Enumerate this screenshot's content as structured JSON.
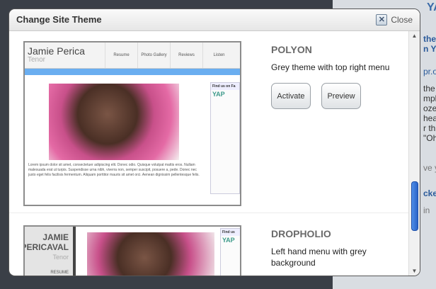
{
  "dialog": {
    "title": "Change Site Theme",
    "close_label": "Close"
  },
  "themes": [
    {
      "name": "POLYON",
      "description": "Grey theme with top right menu",
      "activate_label": "Activate",
      "preview_label": "Preview",
      "preview": {
        "site_name": "Jamie Perica",
        "site_subtitle": "Tenor",
        "nav": [
          "Resume",
          "Photo Gallery",
          "Reviews",
          "Listen"
        ],
        "sidebar_title": "Find us on Fa",
        "sidebar_brand": "YAP",
        "body_text": "Lorem ipsum dolor sit amet, consectetuer adipiscing elit. Donec odio. Quisque volutpat mattis eros. Nullam malesuada erat ut turpis. Suspendisse urna nibh, viverra non, semper suscipit, posuere a, pede. Donec nec justo eget felis facilisis fermentum. Aliquam porttitor mauris sit amet orci. Aenean dignissim pellentesque felis."
      }
    },
    {
      "name": "DROPHOLIO",
      "description": "Left hand menu with grey background",
      "preview": {
        "site_name_line1": "JAMIE",
        "site_name_line2": "PERICAVAL",
        "site_subtitle": "Tenor",
        "menu_item": "RESUME",
        "sidebar_title": "Find us",
        "sidebar_brand": "YAP"
      }
    }
  ],
  "background_page": {
    "snippets": [
      "YAP",
      "the C",
      "n Yo",
      "pr.o",
      "the n",
      "mply",
      "oze",
      "hea",
      "r th",
      "\"Oh",
      "ve yo",
      "ckers",
      "in"
    ]
  }
}
